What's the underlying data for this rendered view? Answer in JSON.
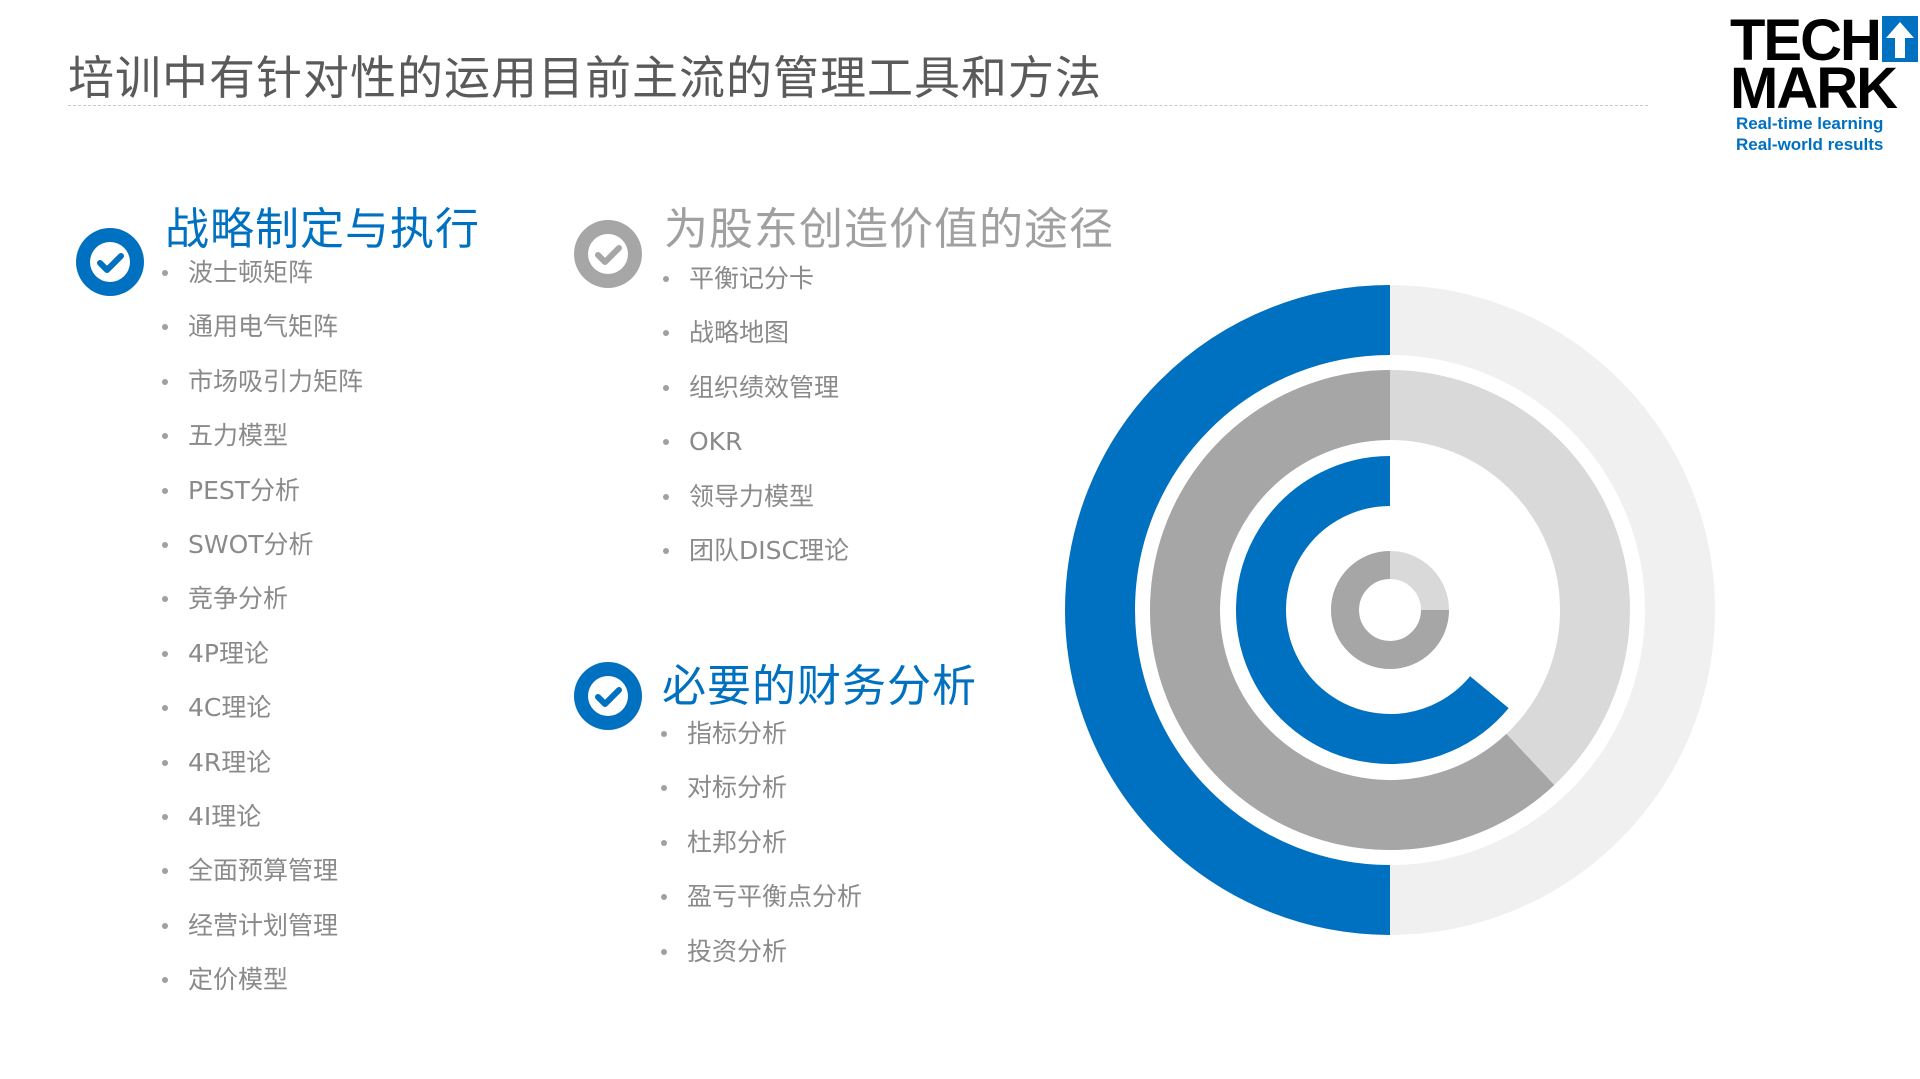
{
  "page": {
    "title": "培训中有针对性的运用目前主流的管理工具和方法"
  },
  "logo": {
    "line1": "TECH",
    "line2": "MARK",
    "tagline1": "Real-time learning",
    "tagline2": "Real-world results"
  },
  "sections": {
    "strategy": {
      "title": "战略制定与执行",
      "status": "checked",
      "items": [
        "波士顿矩阵",
        "通用电气矩阵",
        "市场吸引力矩阵",
        "五力模型",
        "PEST分析",
        "SWOT分析",
        "竞争分析",
        "4P理论",
        "4C理论",
        "4R理论",
        "4I理论",
        "全面预算管理",
        "经营计划管理",
        "定价模型"
      ]
    },
    "shareholder": {
      "title": "为股东创造价值的途径",
      "status": "inactive",
      "items": [
        "平衡记分卡",
        "战略地图",
        "组织绩效管理",
        "OKR",
        "领导力模型",
        "团队DISC理论"
      ]
    },
    "finance": {
      "title": "必要的财务分析",
      "status": "checked",
      "items": [
        "指标分析",
        "对标分析",
        "杜邦分析",
        "盈亏平衡点分析",
        "投资分析"
      ]
    }
  },
  "chart_data": {
    "type": "radial-bar",
    "rings": [
      {
        "fraction": 0.5,
        "color": "#0070c0"
      },
      {
        "fraction": 0.62,
        "color": "#a6a6a6"
      },
      {
        "fraction": 0.64,
        "color": "#0070c0"
      },
      {
        "fraction": 0.75,
        "color": "#a6a6a6"
      }
    ]
  },
  "colors": {
    "accent": "#0070c0",
    "inactive": "#a6a6a6",
    "track_outer": "#f0f0f0",
    "track_inner": "#d9d9d9"
  }
}
